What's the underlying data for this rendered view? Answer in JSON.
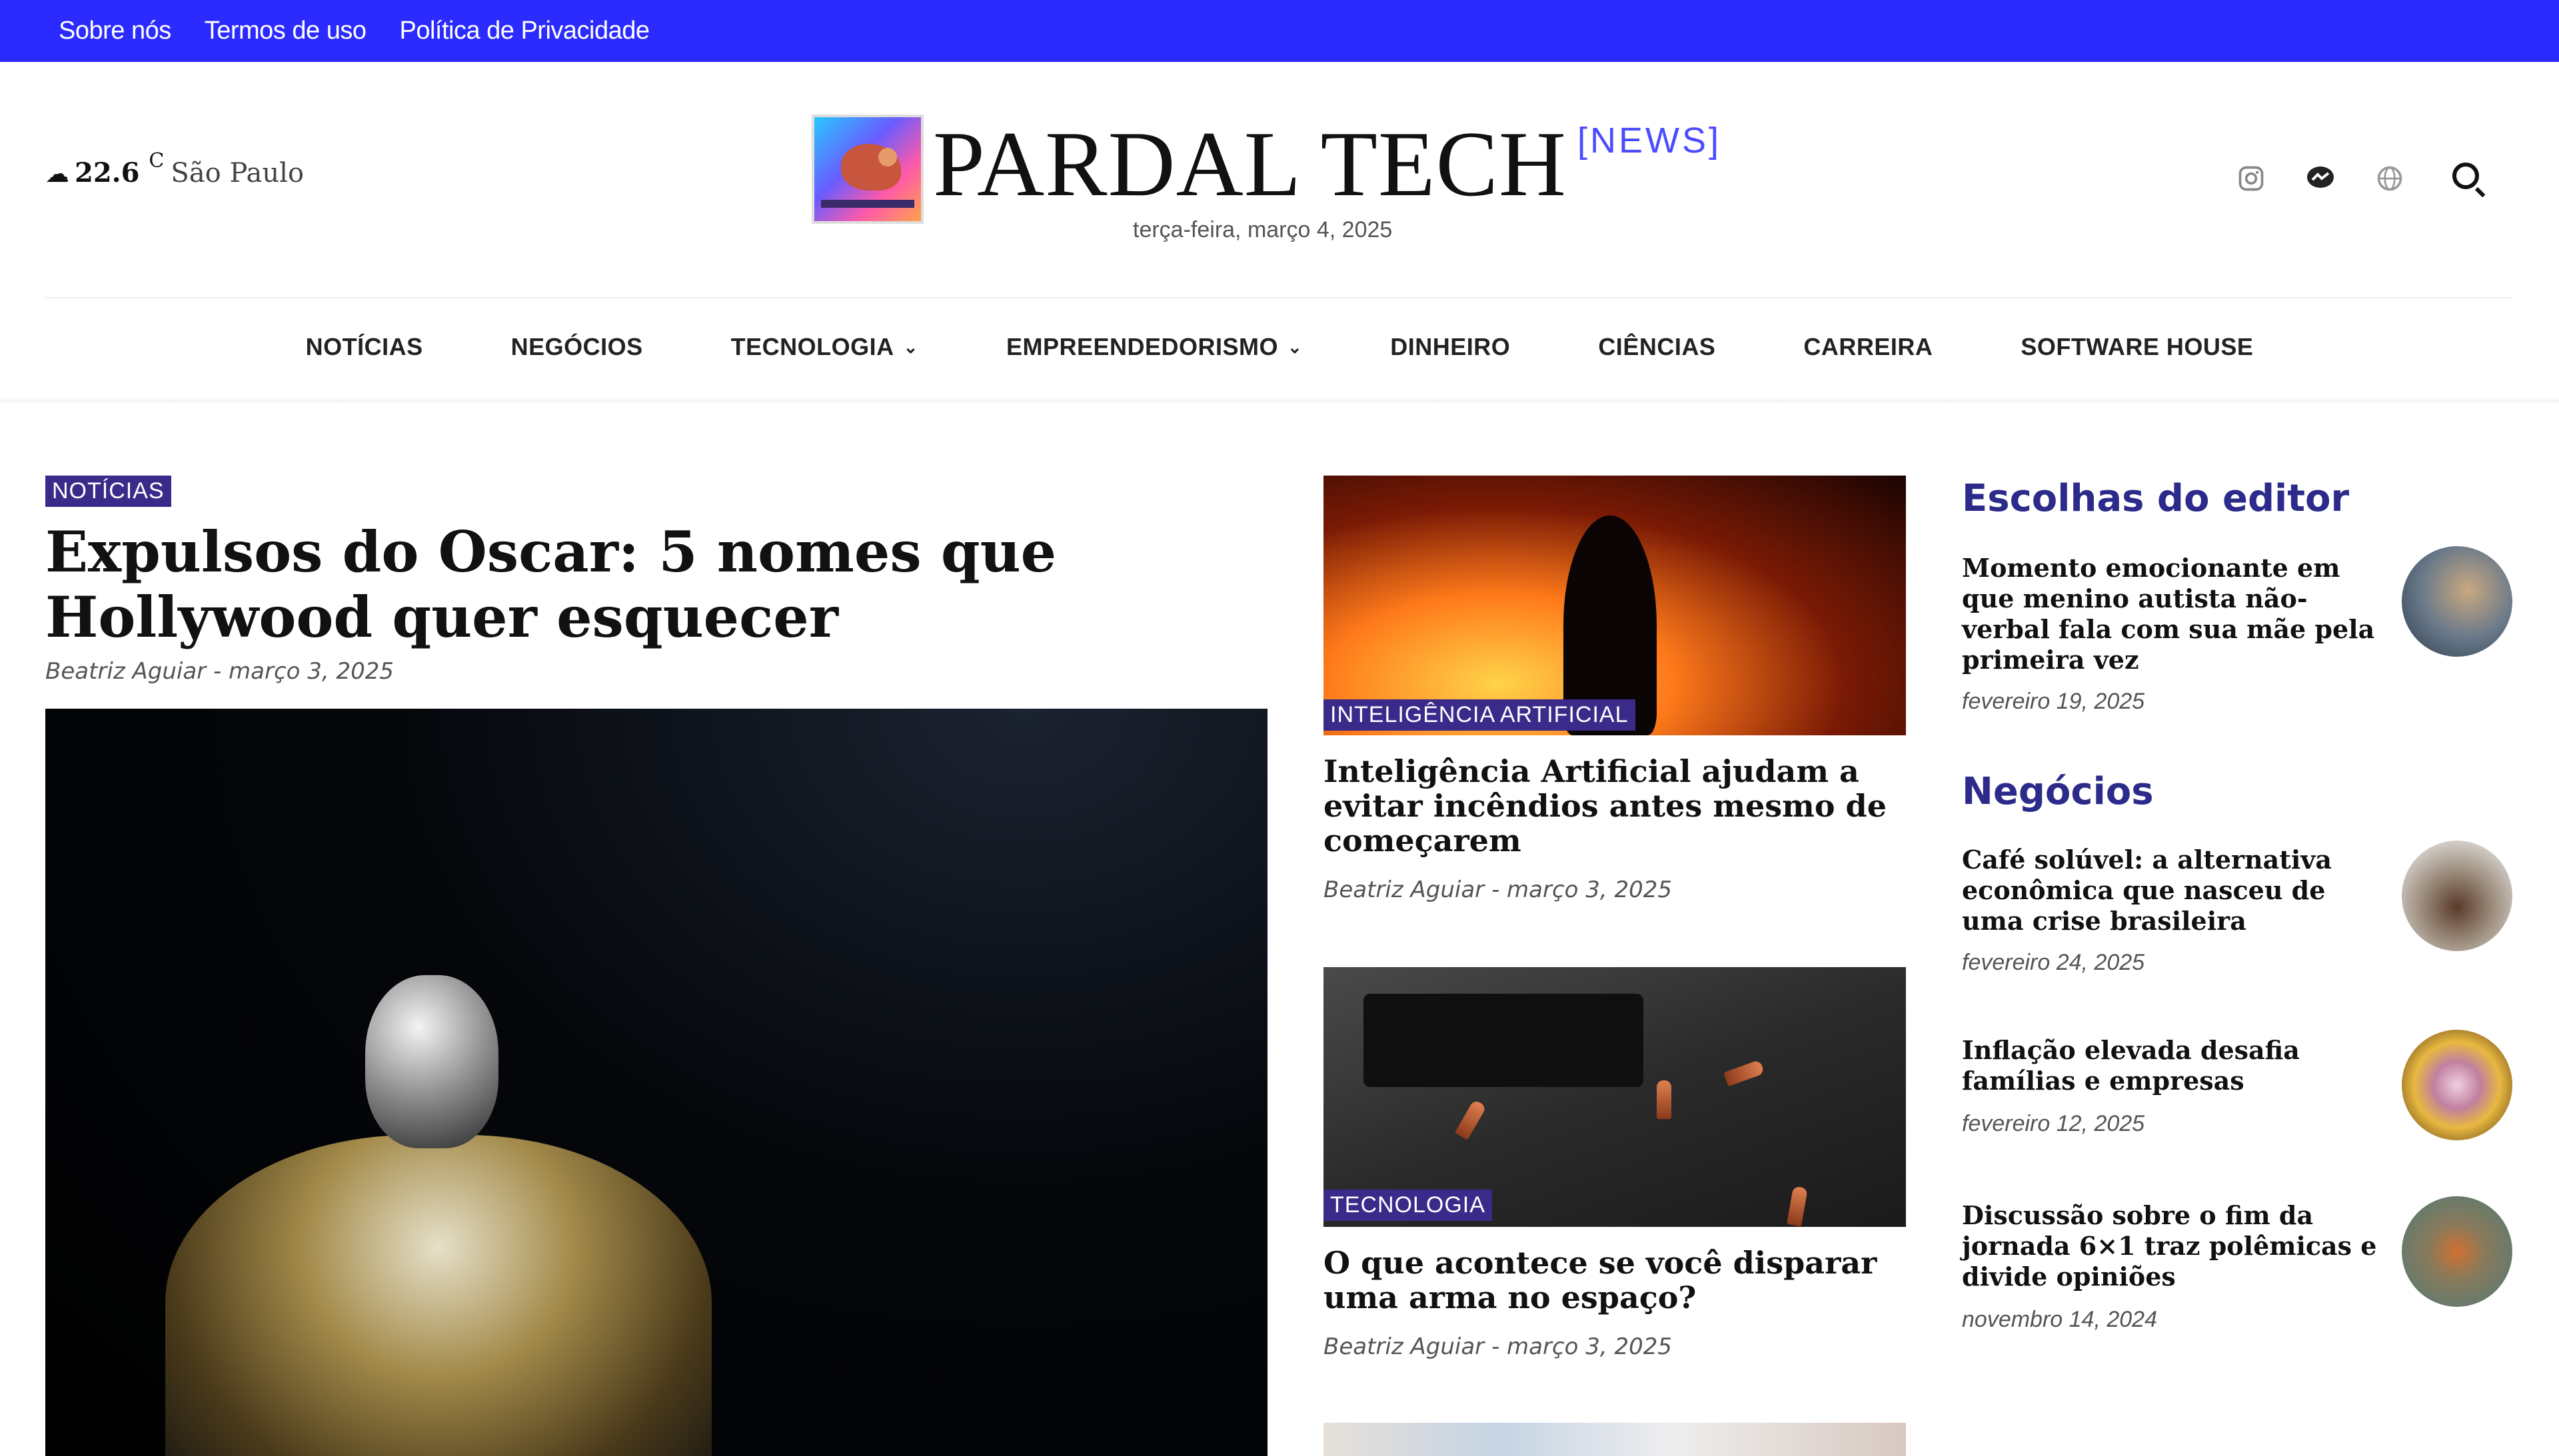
{
  "topbar": {
    "links": [
      "Sobre nós",
      "Termos de uso",
      "Política de Privacidade"
    ]
  },
  "weather": {
    "temp": "22.6",
    "unit": "C",
    "city": "São Paulo"
  },
  "brand": {
    "name": "PARDAL TECH",
    "tag": "[NEWS]",
    "date": "terça-feira, março 4, 2025"
  },
  "nav": {
    "items": [
      "NOTÍCIAS",
      "NEGÓCIOS",
      "TECNOLOGIA",
      "EMPREENDEDORISMO",
      "DINHEIRO",
      "CIÊNCIAS",
      "CARREIRA",
      "SOFTWARE HOUSE"
    ],
    "chevron": "⌄"
  },
  "main_article": {
    "category": "NOTÍCIAS",
    "title": "Expulsos do Oscar: 5 nomes que Hollywood quer esquecer",
    "meta": "Beatriz Aguiar - março 3, 2025"
  },
  "cards": [
    {
      "category": "INTELIGÊNCIA ARTIFICIAL",
      "title": "Inteligência Artificial ajudam a evitar incêndios antes mesmo de começarem",
      "meta": "Beatriz Aguiar - março 3, 2025"
    },
    {
      "category": "TECNOLOGIA",
      "title": "O que acontece se você disparar uma arma no espaço?",
      "meta": "Beatriz Aguiar - março 3, 2025"
    }
  ],
  "sidebar": {
    "editor_title": "Escolhas do editor",
    "editor_items": [
      {
        "title": "Momento emocionante em que menino autista não-verbal fala com sua mãe pela primeira vez",
        "date": "fevereiro 19, 2025"
      }
    ],
    "business_title": "Negócios",
    "business_items": [
      {
        "title": "Café solúvel: a alternativa econômica que nasceu de uma crise brasileira",
        "date": "fevereiro 24, 2025"
      },
      {
        "title": "Inflação elevada desafia famílias e empresas",
        "date": "fevereiro 12, 2025"
      },
      {
        "title": "Discussão sobre o fim da jornada 6×1 traz polêmicas e divide opiniões",
        "date": "novembro 14, 2024"
      }
    ]
  },
  "icons": {
    "weather": "cloud-icon",
    "social": [
      "instagram-icon",
      "messenger-icon",
      "globe-icon"
    ],
    "search": "search-icon"
  },
  "colors": {
    "topbar": "#2b2bff",
    "accent": "#2c2a8a",
    "badge": "#3b2a8a",
    "news_tag": "#4b4bff"
  }
}
